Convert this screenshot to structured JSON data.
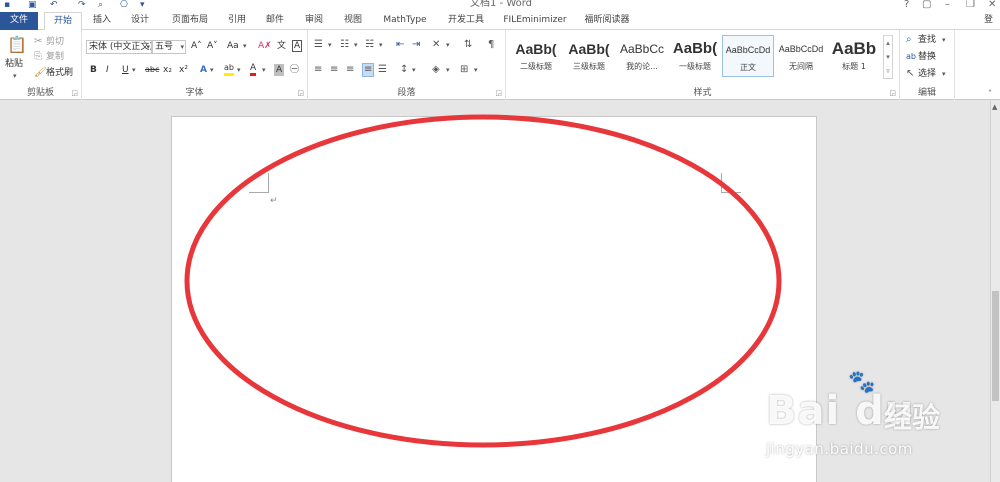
{
  "window": {
    "title": "文档1 - Word",
    "controls": {
      "help": "?",
      "ribbon_display": "▢",
      "minimize": "–",
      "restore": "❐",
      "close": "✕"
    }
  },
  "quick_access": {
    "redo": "↷",
    "undo": "↶",
    "print_preview": "⌕",
    "custom": "⎔"
  },
  "tabs": {
    "file": "文件",
    "home": "开始",
    "insert": "插入",
    "design": "设计",
    "layout": "页面布局",
    "references": "引用",
    "mailings": "邮件",
    "review": "审阅",
    "view": "视图",
    "mathtype": "MathType",
    "developer": "开发工具",
    "fileminimizer": "FILEminimizer",
    "foxit": "福昕阅读器",
    "login": "登录"
  },
  "clipboard": {
    "paste": "粘贴",
    "cut": "剪切",
    "copy": "复制",
    "format_painter": "格式刷",
    "label": "剪贴板"
  },
  "font": {
    "name": "宋体 (中文正文)",
    "size": "五号",
    "grow": "A˄",
    "shrink": "A˅",
    "change_case": "Aa",
    "clear_format": "A✗",
    "phonetic": "文",
    "border_char": "A",
    "bold": "B",
    "italic": "I",
    "underline": "U",
    "strike": "abc",
    "subscript": "x₂",
    "superscript": "x²",
    "text_effects": "A",
    "highlight": "ab",
    "font_color": "A",
    "shading": "A",
    "encircle": "㊀",
    "label": "字体",
    "font_color_value": "#e02020",
    "highlight_value": "#ffee00"
  },
  "paragraph": {
    "label": "段落"
  },
  "styles": {
    "label": "样式",
    "items": [
      {
        "sample": "AaBb(",
        "name": "二级标题"
      },
      {
        "sample": "AaBb(",
        "name": "三级标题"
      },
      {
        "sample": "AaBbCc",
        "name": "我的论..."
      },
      {
        "sample": "AaBb(",
        "name": "一级标题"
      },
      {
        "sample": "AaBbCcDd",
        "name": "正文"
      },
      {
        "sample": "AaBbCcDd",
        "name": "无间隔"
      },
      {
        "sample": "AaBb",
        "name": "标题 1"
      }
    ]
  },
  "editing": {
    "find": "查找",
    "replace": "替换",
    "select": "选择",
    "label": "编辑"
  },
  "document": {
    "paragraph_mark": "↵"
  },
  "annotation": {
    "shape": "ellipse",
    "color": "#e8373b"
  },
  "watermark": {
    "logo": "Bai du",
    "cn": "经验",
    "url": "jingyan.baidu.com"
  }
}
